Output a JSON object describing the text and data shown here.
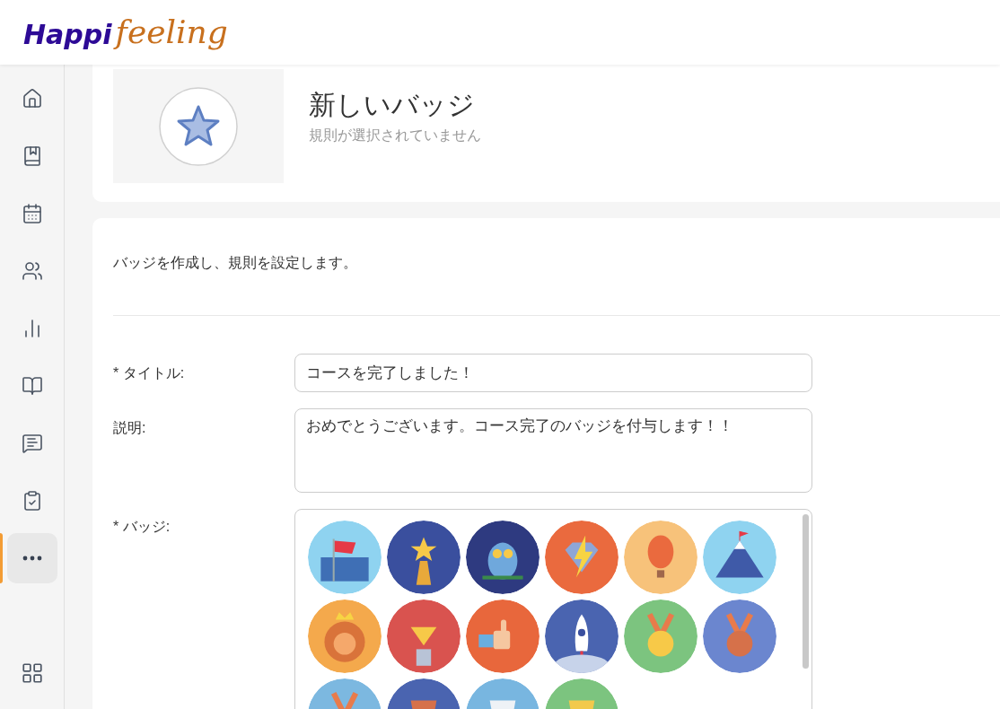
{
  "logo": {
    "part_1": "Happi",
    "part_2": "feeling"
  },
  "sidebar": {
    "items": [
      {
        "kind": "home",
        "selected": false
      },
      {
        "kind": "book",
        "selected": false
      },
      {
        "kind": "calendar",
        "selected": false
      },
      {
        "kind": "users",
        "selected": false
      },
      {
        "kind": "chart",
        "selected": false
      },
      {
        "kind": "info",
        "selected": false
      },
      {
        "kind": "help",
        "selected": false
      },
      {
        "kind": "clipboard",
        "selected": false
      },
      {
        "kind": "more",
        "selected": true
      }
    ],
    "bottom_item": {
      "kind": "apps"
    }
  },
  "preview": {
    "title": "新しいバッジ",
    "subtitle": "規則が選択されていません"
  },
  "form": {
    "intro": "バッジを作成し、規則を設定します。",
    "fields": [
      {
        "label": "* タイトル:",
        "value": "コースを完了しました！"
      },
      {
        "label": "説明:",
        "value": "おめでとうございます。コース完了のバッジを付与します！！"
      }
    ],
    "badge_label": "* バッジ:",
    "badges": [
      {
        "kind": "flag"
      },
      {
        "kind": "star"
      },
      {
        "kind": "owl"
      },
      {
        "kind": "bolt"
      },
      {
        "kind": "balloon"
      },
      {
        "kind": "mountain"
      },
      {
        "kind": "lion"
      },
      {
        "kind": "diamond"
      },
      {
        "kind": "thumb"
      },
      {
        "kind": "rocket"
      },
      {
        "kind": "medal1"
      },
      {
        "kind": "medal3"
      },
      {
        "kind": "medal2"
      },
      {
        "kind": "cup_bronze"
      },
      {
        "kind": "cup_silver"
      },
      {
        "kind": "cup_gold"
      }
    ]
  }
}
